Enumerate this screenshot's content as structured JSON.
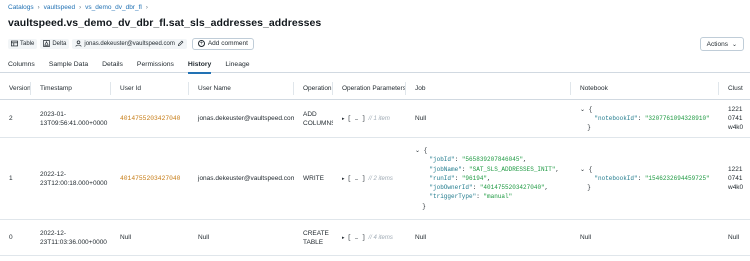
{
  "breadcrumb": {
    "items": [
      "Catalogs",
      "vaultspeed",
      "vs_demo_dv_dbr_fl"
    ]
  },
  "page": {
    "title": "vaultspeed.vs_demo_dv_dbr_fl.sat_sls_addresses_addresses"
  },
  "meta": {
    "type_label": "Table",
    "format_label": "Delta",
    "owner": "jonas.dekeuster@vaultspeed.com",
    "add_comment_label": "Add comment"
  },
  "actions": {
    "label": "Actions"
  },
  "tabs": [
    {
      "label": "Columns",
      "active": false
    },
    {
      "label": "Sample Data",
      "active": false
    },
    {
      "label": "Details",
      "active": false
    },
    {
      "label": "Permissions",
      "active": false
    },
    {
      "label": "History",
      "active": true
    },
    {
      "label": "Lineage",
      "active": false
    }
  ],
  "table": {
    "headers": [
      "Version",
      "Timestamp",
      "User Id",
      "User Name",
      "Operation",
      "Operation Parameters",
      "Job",
      "Notebook",
      "Clust"
    ],
    "rows": [
      {
        "version": "2",
        "timestamp": [
          "2023-01-",
          "13T09:56:41.000+0000"
        ],
        "user_id": "4014755203427040",
        "user_name": "jonas.dekeuster@vaultspeed.com",
        "operation": [
          "ADD",
          "COLUMNS"
        ],
        "op_params": {
          "count": "// 1 item"
        },
        "job": "Null",
        "notebook": {
          "key": "\"notebookId\"",
          "value": "\"3207761094328910\""
        },
        "cluster": [
          "1221",
          "0741",
          "w4k0"
        ]
      },
      {
        "version": "1",
        "timestamp": [
          "2022-12-",
          "23T12:00:18.000+0000"
        ],
        "user_id": "4014755203427040",
        "user_name": "jonas.dekeuster@vaultspeed.com",
        "operation": [
          "WRITE"
        ],
        "op_params": {
          "count": "// 2 items"
        },
        "job": {
          "jobId": "\"565839207846045\"",
          "jobName": "\"SAT_SLS_ADDRESSES_INIT\"",
          "runId": "\"96194\"",
          "jobOwnerId": "\"4014755203427040\"",
          "triggerType": "\"manual\""
        },
        "notebook": {
          "key": "\"notebookId\"",
          "value": "\"1546232694459725\""
        },
        "cluster": [
          "1221",
          "0741",
          "w4k0"
        ]
      },
      {
        "version": "0",
        "timestamp": [
          "2022-12-",
          "23T11:03:36.000+0000"
        ],
        "user_id": "Null",
        "user_name": "Null",
        "operation": [
          "CREATE",
          "TABLE"
        ],
        "op_params": {
          "count": "// 4 items"
        },
        "job": "Null",
        "notebook": "Null",
        "cluster": [
          "Null"
        ]
      }
    ]
  },
  "colors": {
    "link": "#2272b4",
    "user_id": "#c77d17",
    "json_key": "#1f7a8c",
    "json_string": "#1c9940"
  }
}
